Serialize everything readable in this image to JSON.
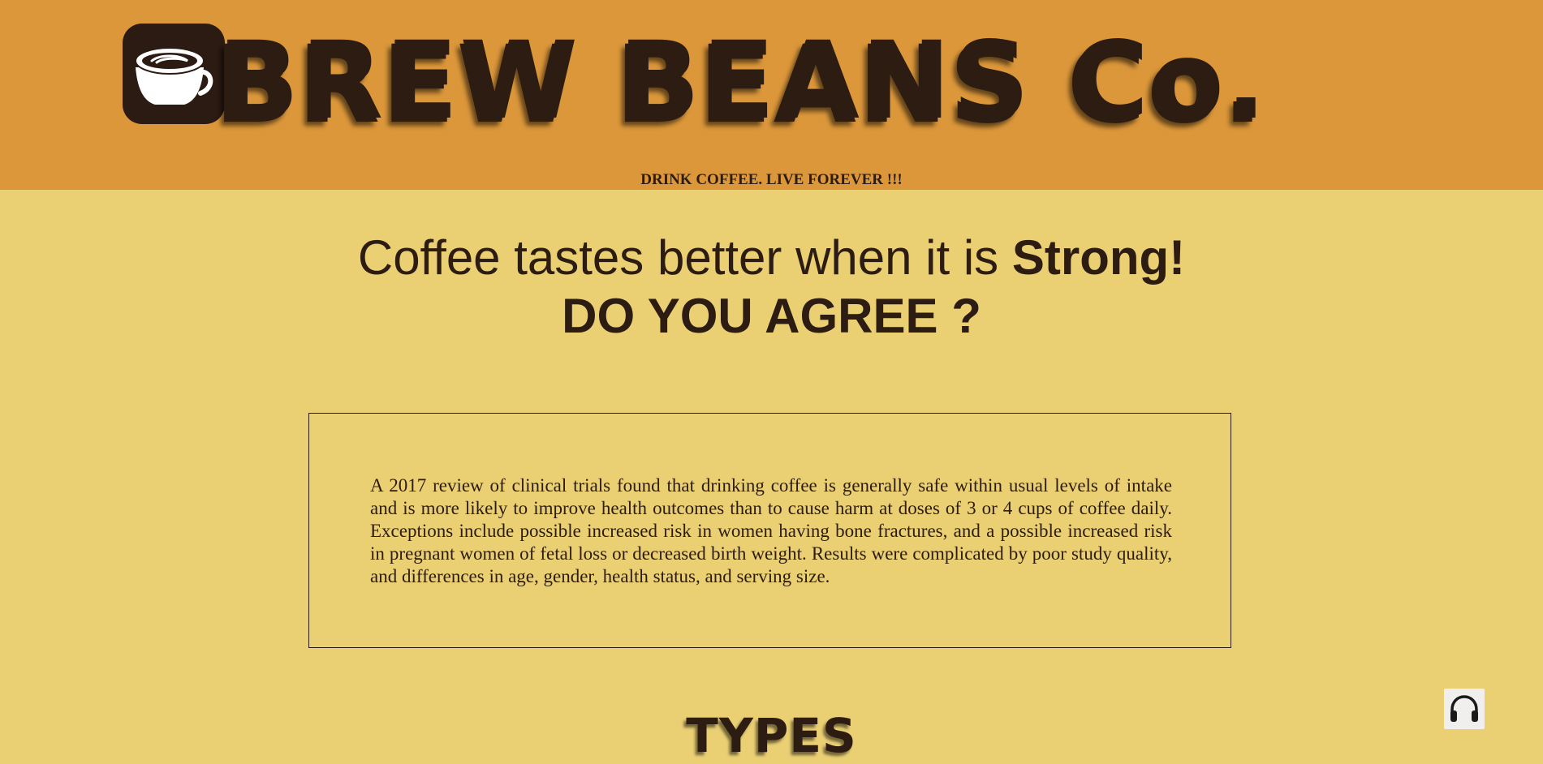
{
  "header": {
    "brand_title": "BREW BEANS Co.",
    "tagline": "DRINK COFFEE. LIVE FOREVER !!!",
    "logo_icon": "coffee-cup-icon"
  },
  "hero": {
    "line1_prefix": "Coffee tastes better when it is ",
    "line1_strong": "Strong!",
    "line2": "DO YOU AGREE ?"
  },
  "info": {
    "paragraph": "A 2017 review of clinical trials found that drinking coffee is generally safe within usual levels of intake and is more likely to improve health outcomes than to cause harm at doses of 3 or 4 cups of coffee daily. Exceptions include possible increased risk in women having bone fractures, and a possible increased risk in pregnant women of fetal loss or decreased birth weight. Results were complicated by poor study quality, and differences in age, gender, health status, and serving size."
  },
  "types": {
    "heading": "TYPES"
  },
  "audio": {
    "icon": "headphones-icon"
  },
  "colors": {
    "header_bg": "#dc973a",
    "page_bg": "#eacf73",
    "text_dark": "#2c1c11",
    "logo_bg": "#2b1b12"
  }
}
